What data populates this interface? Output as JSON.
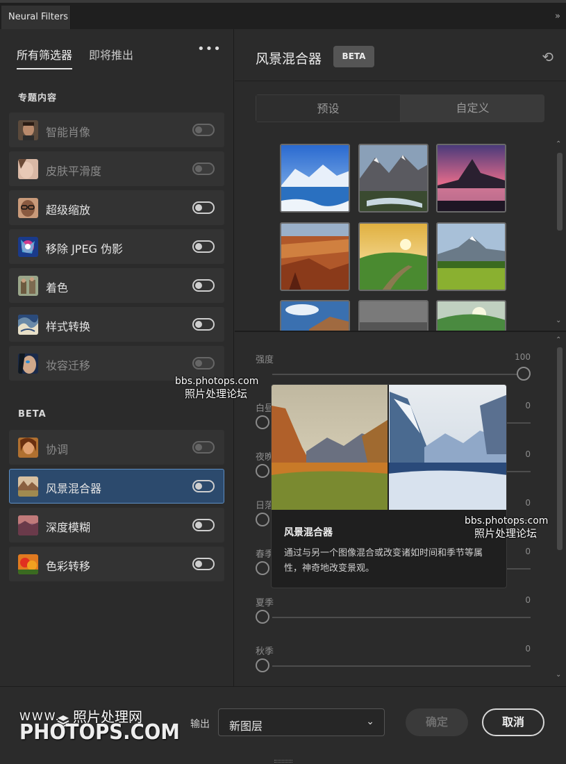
{
  "window": {
    "tab_title": "Neural Filters",
    "collapse_glyph": "»"
  },
  "left": {
    "tabs": [
      {
        "label": "所有筛选器",
        "active": true
      },
      {
        "label": "即将推出",
        "active": false
      }
    ],
    "more_glyph": "•••",
    "featured_heading": "专题内容",
    "featured": [
      {
        "label": "智能肖像",
        "icon": "portrait-thumb",
        "enabled": false
      },
      {
        "label": "皮肤平滑度",
        "icon": "skin-thumb",
        "enabled": false
      },
      {
        "label": "超级缩放",
        "icon": "zoom-thumb",
        "enabled": true
      },
      {
        "label": "移除 JPEG 伪影",
        "icon": "jpeg-thumb",
        "enabled": true
      },
      {
        "label": "着色",
        "icon": "colorize-thumb",
        "enabled": true
      },
      {
        "label": "样式转换",
        "icon": "style-thumb",
        "enabled": true
      },
      {
        "label": "妆容迁移",
        "icon": "makeup-thumb",
        "enabled": false
      }
    ],
    "beta_heading": "BETA",
    "beta": [
      {
        "label": "协调",
        "icon": "harmonize-thumb",
        "enabled": false
      },
      {
        "label": "风景混合器",
        "icon": "landscape-thumb",
        "enabled": true,
        "selected": true
      },
      {
        "label": "深度模糊",
        "icon": "depth-thumb",
        "enabled": true
      },
      {
        "label": "色彩转移",
        "icon": "color-transfer-thumb",
        "enabled": true
      }
    ]
  },
  "right": {
    "title": "风景混合器",
    "badge": "BETA",
    "reset_glyph": "⟲",
    "segments": [
      {
        "label": "预设",
        "active": true
      },
      {
        "label": "自定义",
        "active": false
      }
    ],
    "sliders": [
      {
        "label": "强度",
        "value": "100",
        "fraction": 1.0
      },
      {
        "label": "白昼",
        "value": "0",
        "fraction": 0.0
      },
      {
        "label": "夜晚",
        "value": "0",
        "fraction": 0.0
      },
      {
        "label": "日落",
        "value": "0",
        "fraction": 0.0
      },
      {
        "label": "春季",
        "value": "0",
        "fraction": 0.0
      },
      {
        "label": "夏季",
        "value": "0",
        "fraction": 0.0
      },
      {
        "label": "秋季",
        "value": "0",
        "fraction": 0.0
      }
    ]
  },
  "popup": {
    "title": "风景混合器",
    "description": "通过与另一个图像混合或改变诸如时间和季节等属性，神奇地改变景观。"
  },
  "watermarks": {
    "line1": "bbs.photops.com",
    "line2": "照片处理论坛"
  },
  "footer": {
    "output_label": "输出",
    "output_value": "新图层",
    "ok_label": "确定",
    "cancel_label": "取消",
    "logo_www": "WWW.",
    "logo_cn": "照片处理网",
    "logo_big": "PHOTOPS.COM"
  }
}
